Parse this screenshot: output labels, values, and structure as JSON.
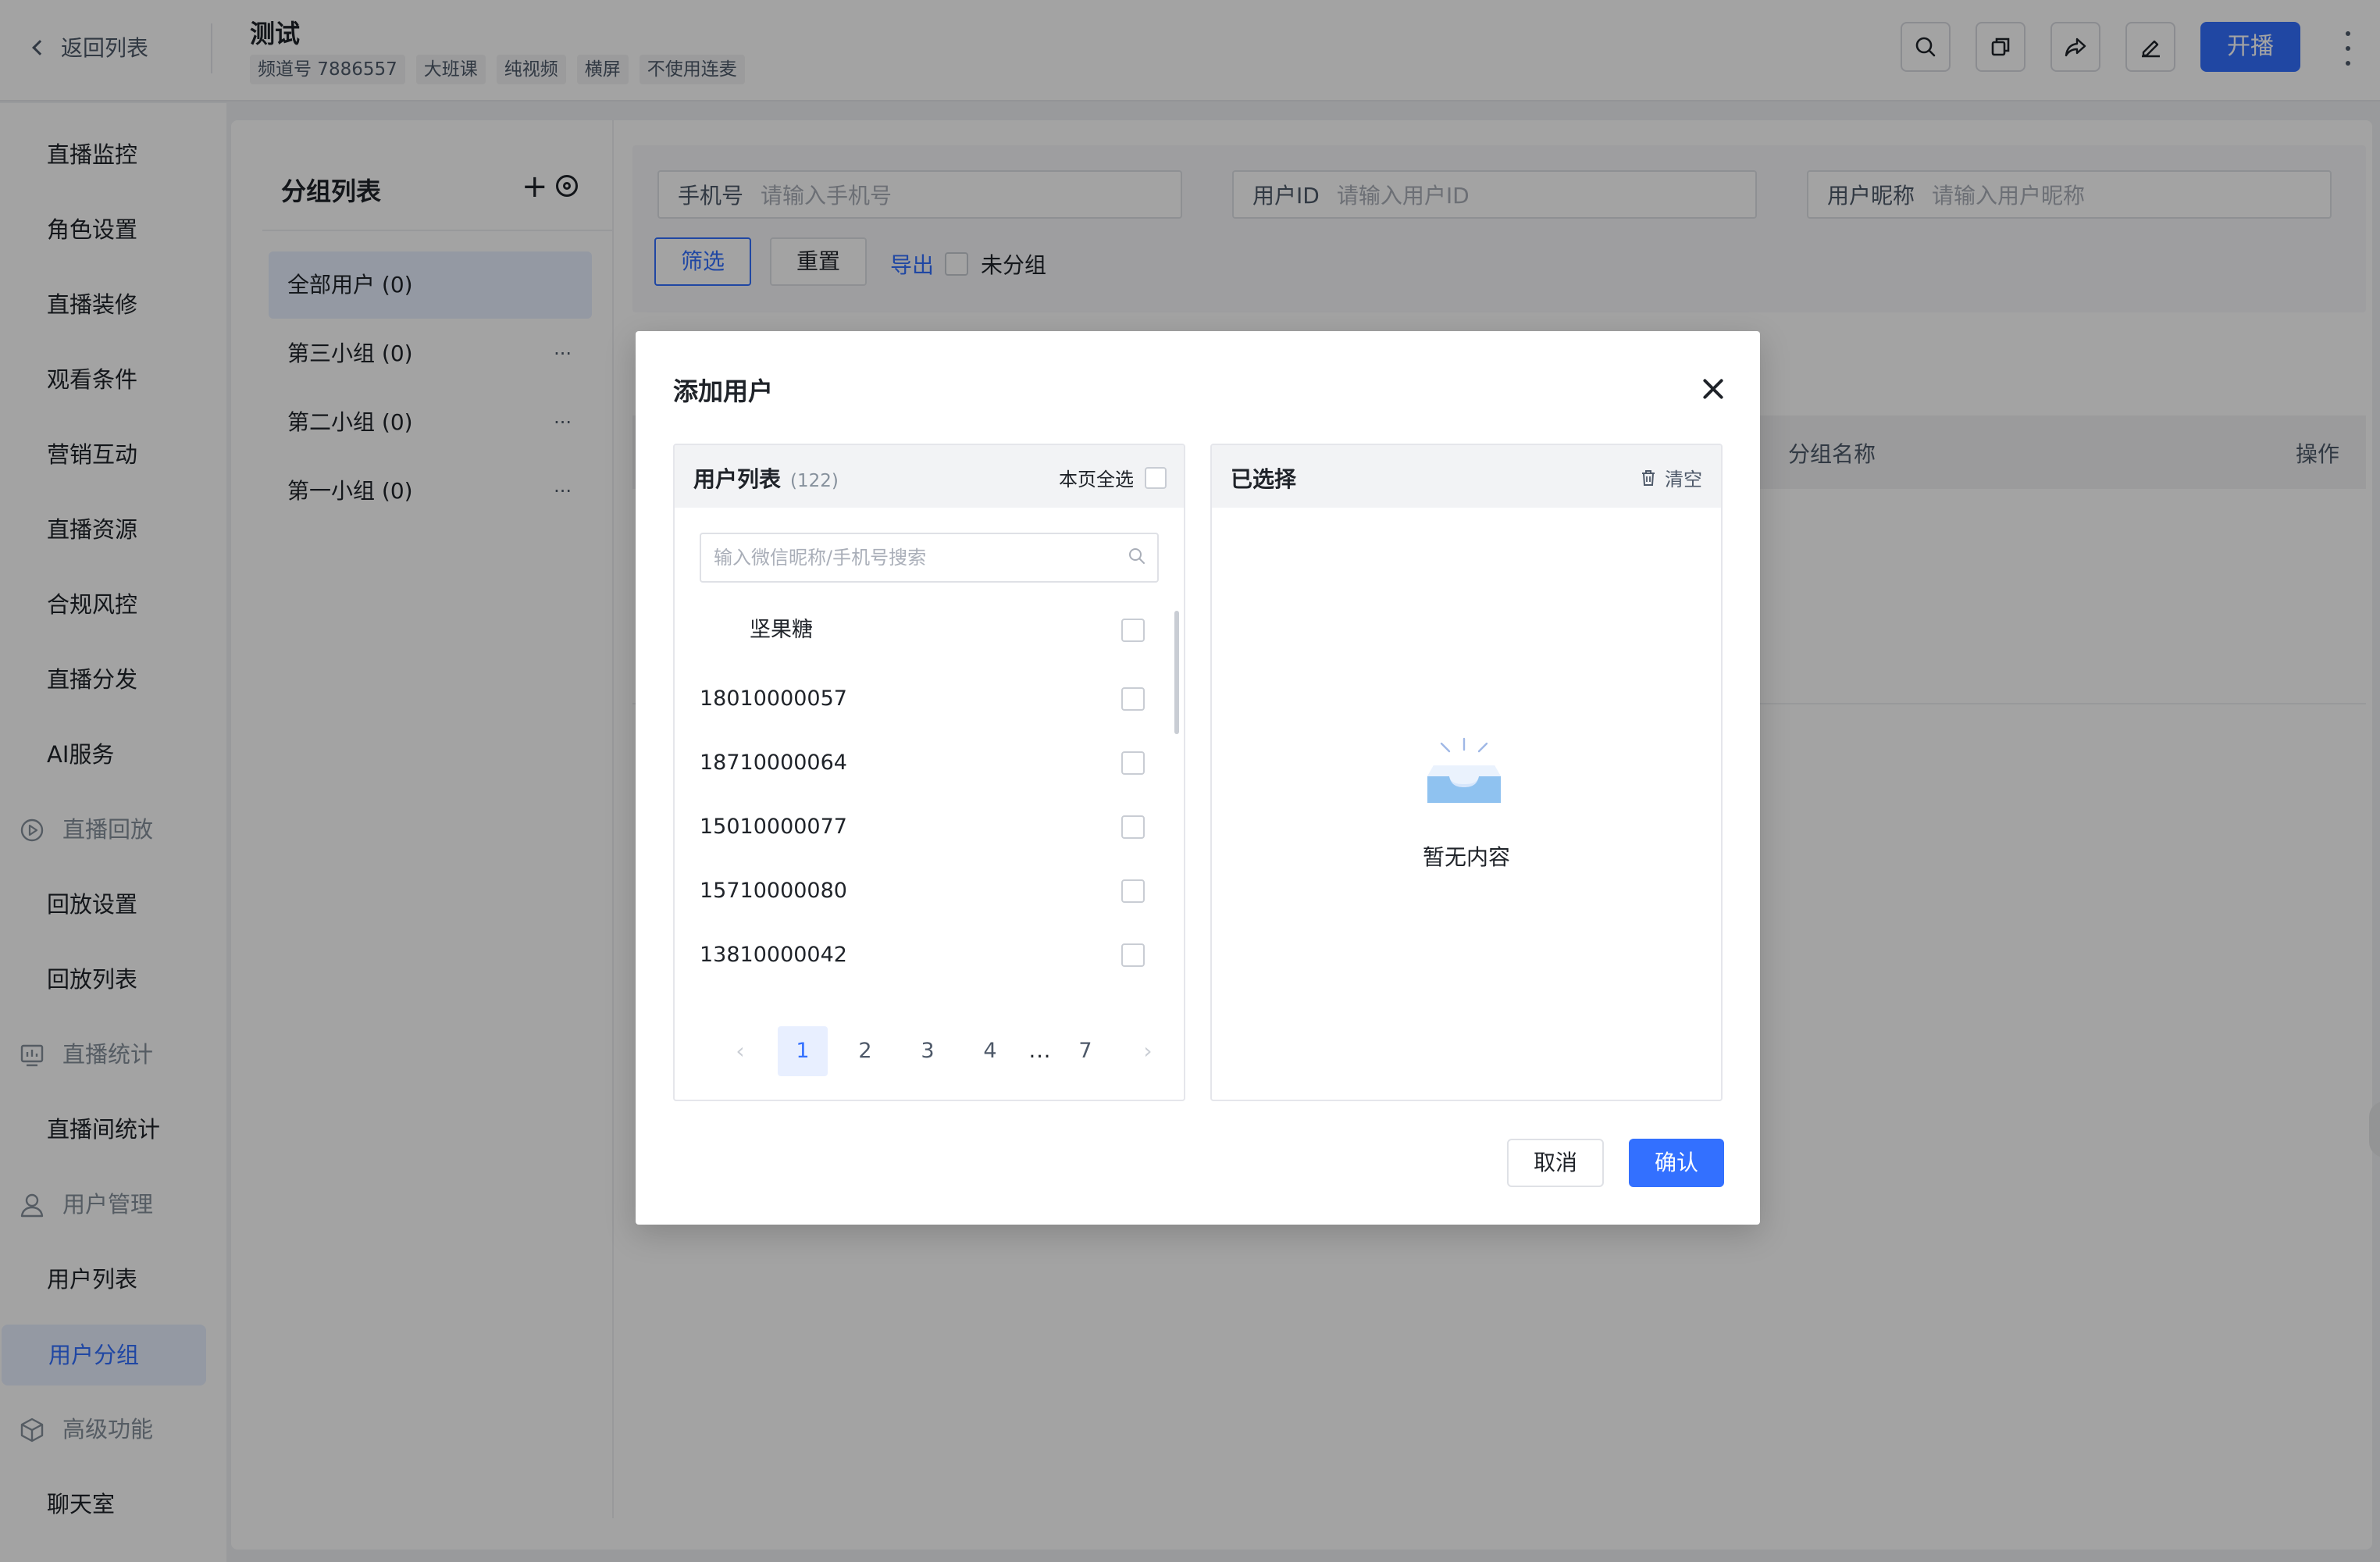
{
  "header": {
    "back_label": "返回列表",
    "title": "测试",
    "tags": [
      "频道号 7886557",
      "大班课",
      "纯视频",
      "横屏",
      "不使用连麦"
    ],
    "start_label": "开播"
  },
  "sidebar": {
    "items": [
      {
        "label": "直播监控",
        "type": "item"
      },
      {
        "label": "角色设置",
        "type": "item"
      },
      {
        "label": "直播装修",
        "type": "item"
      },
      {
        "label": "观看条件",
        "type": "item"
      },
      {
        "label": "营销互动",
        "type": "item"
      },
      {
        "label": "直播资源",
        "type": "item"
      },
      {
        "label": "合规风控",
        "type": "item"
      },
      {
        "label": "直播分发",
        "type": "item"
      },
      {
        "label": "AI服务",
        "type": "item"
      },
      {
        "label": "直播回放",
        "type": "group"
      },
      {
        "label": "回放设置",
        "type": "item"
      },
      {
        "label": "回放列表",
        "type": "item"
      },
      {
        "label": "直播统计",
        "type": "group"
      },
      {
        "label": "直播间统计",
        "type": "item"
      },
      {
        "label": "用户管理",
        "type": "group"
      },
      {
        "label": "用户列表",
        "type": "item"
      },
      {
        "label": "用户分组",
        "type": "item",
        "active": true
      },
      {
        "label": "高级功能",
        "type": "group"
      },
      {
        "label": "聊天室",
        "type": "item"
      }
    ]
  },
  "groups": {
    "title": "分组列表",
    "items": [
      {
        "label": "全部用户 (0)",
        "active": true
      },
      {
        "label": "第三小组 (0)"
      },
      {
        "label": "第二小组 (0)"
      },
      {
        "label": "第一小组 (0)"
      }
    ],
    "more_label": "···"
  },
  "filter": {
    "phone_label": "手机号",
    "phone_placeholder": "请输入手机号",
    "uid_label": "用户ID",
    "uid_placeholder": "请输入用户ID",
    "nick_label": "用户昵称",
    "nick_placeholder": "请输入用户昵称",
    "filter_btn": "筛选",
    "reset_btn": "重置",
    "export_link": "导出",
    "ungrouped_label": "未分组"
  },
  "table": {
    "col_group_name": "分组名称",
    "col_action": "操作"
  },
  "modal": {
    "title": "添加用户",
    "user_list_title": "用户列表",
    "user_count": "(122)",
    "select_page_all": "本页全选",
    "search_placeholder": "输入微信昵称/手机号搜索",
    "users": [
      "坚果糖",
      "18010000057",
      "18710000064",
      "15010000077",
      "15710000080",
      "13810000042"
    ],
    "pages": [
      "1",
      "2",
      "3",
      "4",
      "...",
      "7"
    ],
    "prev_label": "‹",
    "next_label": "›",
    "selected_title": "已选择",
    "clear_label": "清空",
    "empty_text": "暂无内容",
    "cancel_label": "取消",
    "confirm_label": "确认"
  },
  "colors": {
    "primary": "#3370ff",
    "overlay": "rgba(0,0,0,0.36)"
  }
}
